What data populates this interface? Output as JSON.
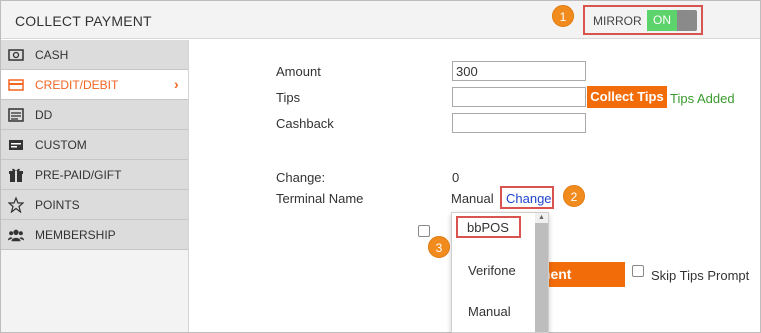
{
  "header": {
    "title": "COLLECT PAYMENT",
    "mirror_label": "MIRROR",
    "mirror_toggle": "ON"
  },
  "badges": [
    "1",
    "2",
    "3"
  ],
  "sidebar": {
    "items": [
      {
        "label": "CASH",
        "icon": "cash-icon"
      },
      {
        "label": "CREDIT/DEBIT",
        "icon": "credit-card-icon",
        "active": true
      },
      {
        "label": "DD",
        "icon": "dd-icon"
      },
      {
        "label": "CUSTOM",
        "icon": "custom-icon"
      },
      {
        "label": "PRE-PAID/GIFT",
        "icon": "gift-icon"
      },
      {
        "label": "POINTS",
        "icon": "star-icon"
      },
      {
        "label": "MEMBERSHIP",
        "icon": "group-icon"
      }
    ]
  },
  "form": {
    "amount_label": "Amount",
    "amount_value": "300",
    "tips_label": "Tips",
    "tips_value": "",
    "cashback_label": "Cashback",
    "cashback_value": "",
    "collect_tips_button": "Collect Tips",
    "tips_added": "Tips Added",
    "change_label": "Change:",
    "change_value": "0",
    "terminal_label": "Terminal Name",
    "terminal_value": "Manual",
    "change_link": "Change"
  },
  "dropdown": {
    "options": [
      "bbPOS",
      "Verifone",
      "Manual"
    ]
  },
  "footer": {
    "pay_button": "ment",
    "skip_tips_label": "Skip Tips Prompt"
  },
  "colors": {
    "accent": "#f26d0a",
    "highlight_border": "#d9534f",
    "toggle_on": "#5cd36b",
    "tips_added": "#3a9b2e",
    "link": "#2244cc",
    "badge": "#f28b1d"
  }
}
